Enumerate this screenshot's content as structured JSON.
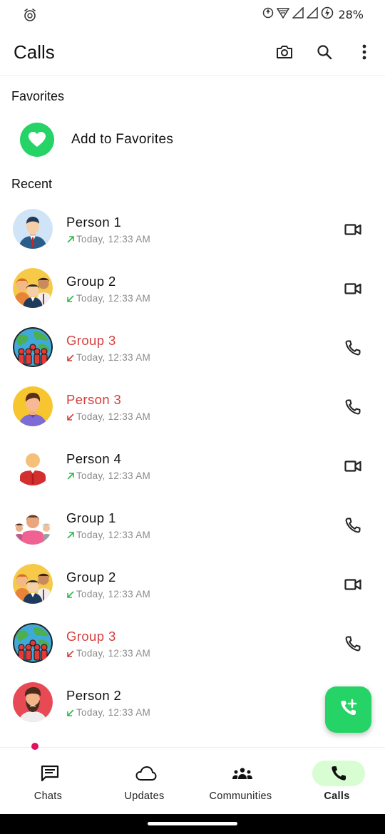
{
  "status_bar": {
    "left_icon": "alarm-icon",
    "right_icons": [
      "data-saver-icon",
      "wifi-icon",
      "signal-icon",
      "signal-icon-2",
      "battery-charging-icon"
    ],
    "battery_percent": "28%"
  },
  "app_bar": {
    "title": "Calls",
    "actions": [
      "camera-icon",
      "search-icon",
      "more-vert-icon"
    ]
  },
  "favorites": {
    "section_label": "Favorites",
    "add_label": "Add to Favorites",
    "icon": "heart-icon"
  },
  "recent": {
    "section_label": "Recent",
    "calls": [
      {
        "name": "Person 1",
        "time": "Today, 12:33 AM",
        "direction": "outgoing",
        "missed": false,
        "type": "video",
        "avatar": "person-1"
      },
      {
        "name": "Group 2",
        "time": "Today, 12:33 AM",
        "direction": "incoming",
        "missed": false,
        "type": "video",
        "avatar": "group-2"
      },
      {
        "name": "Group 3",
        "time": "Today, 12:33 AM",
        "direction": "incoming",
        "missed": true,
        "type": "voice",
        "avatar": "group-3"
      },
      {
        "name": "Person 3",
        "time": "Today, 12:33 AM",
        "direction": "incoming",
        "missed": true,
        "type": "voice",
        "avatar": "person-3"
      },
      {
        "name": "Person 4",
        "time": "Today, 12:33 AM",
        "direction": "outgoing",
        "missed": false,
        "type": "video",
        "avatar": "person-4"
      },
      {
        "name": "Group 1",
        "time": "Today, 12:33 AM",
        "direction": "outgoing",
        "missed": false,
        "type": "voice",
        "avatar": "group-1"
      },
      {
        "name": "Group 2",
        "time": "Today, 12:33 AM",
        "direction": "incoming",
        "missed": false,
        "type": "video",
        "avatar": "group-2"
      },
      {
        "name": "Group 3",
        "time": "Today, 12:33 AM",
        "direction": "incoming",
        "missed": true,
        "type": "voice",
        "avatar": "group-3"
      },
      {
        "name": "Person 2",
        "time": "Today, 12:33 AM",
        "direction": "incoming",
        "missed": false,
        "type": "voice",
        "avatar": "person-2"
      }
    ]
  },
  "fab": {
    "icon": "add-call-icon"
  },
  "bottom_nav": {
    "items": [
      {
        "label": "Chats",
        "icon": "chat-icon",
        "active": false
      },
      {
        "label": "Updates",
        "icon": "cloud-icon",
        "active": false
      },
      {
        "label": "Communities",
        "icon": "communities-icon",
        "active": false
      },
      {
        "label": "Calls",
        "icon": "phone-icon",
        "active": true
      }
    ]
  },
  "colors": {
    "accent": "#25d366",
    "active_pill": "#d8fdd2",
    "missed": "#d63d3d",
    "arrow_green": "#2eb84a",
    "arrow_red": "#d63d3d",
    "meta_gray": "#8a8a8a"
  }
}
